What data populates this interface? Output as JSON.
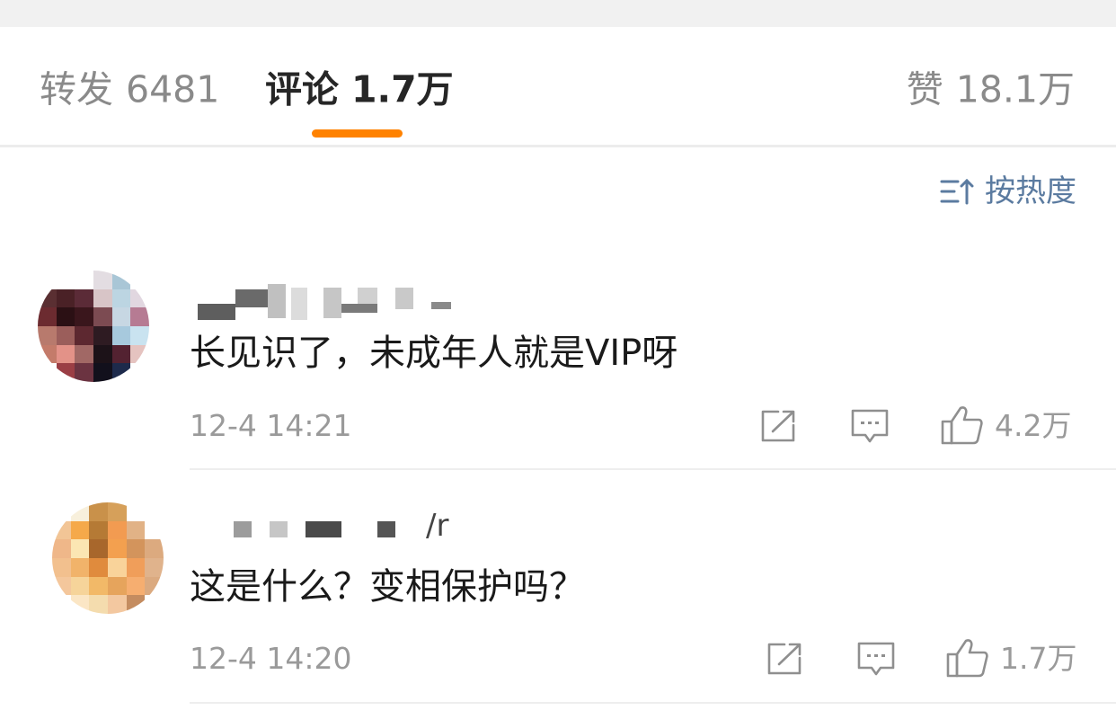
{
  "tabs": {
    "forward": {
      "label": "转发",
      "count": "6481"
    },
    "comment": {
      "label": "评论",
      "count": "1.7万"
    },
    "like": {
      "label": "赞",
      "count": "18.1万"
    }
  },
  "sort": {
    "label": "按热度",
    "icon": "sort-icon"
  },
  "colors": {
    "accent": "#ff8200",
    "sort": "#5b7ba0",
    "meta": "#9a9a9a"
  },
  "comments": [
    {
      "username_visible": "",
      "text": "长见识了，未成年人就是VIP呀",
      "time": "12-4 14:21",
      "likes": "4.2万"
    },
    {
      "username_visible": "/r",
      "text": "这是什么？变相保护吗？",
      "time": "12-4 14:20",
      "likes": "1.7万"
    }
  ]
}
